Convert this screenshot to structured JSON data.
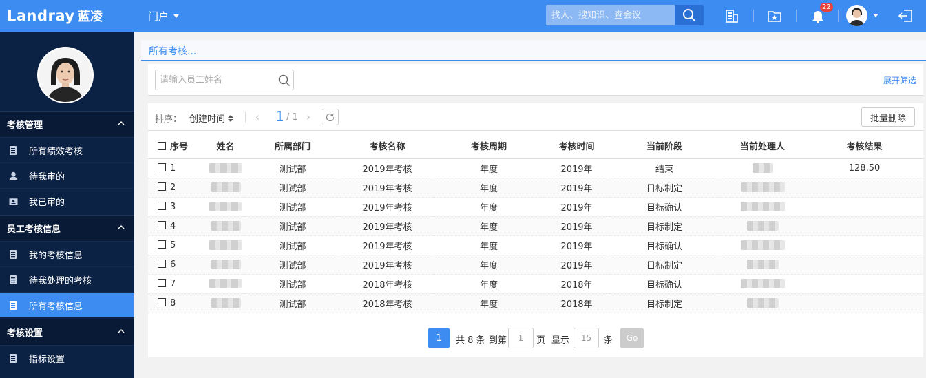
{
  "header": {
    "logo_text": "Landray",
    "logo_cn": "蓝凌",
    "portal_label": "门户",
    "search_placeholder": "找人、搜知识、查会议",
    "notification_count": "22",
    "accent_color": "#3d8cf1"
  },
  "sidebar": {
    "groups": [
      {
        "label": "考核管理",
        "items": [
          {
            "label": "所有绩效考核",
            "icon": "document-icon"
          },
          {
            "label": "待我审的",
            "icon": "user-icon"
          },
          {
            "label": "我已审的",
            "icon": "contact-card-icon"
          }
        ]
      },
      {
        "label": "员工考核信息",
        "items": [
          {
            "label": "我的考核信息",
            "icon": "document-icon"
          },
          {
            "label": "待我处理的考核",
            "icon": "document-icon"
          },
          {
            "label": "所有考核信息",
            "icon": "document-icon",
            "active": true
          }
        ]
      },
      {
        "label": "考核设置",
        "items": [
          {
            "label": "指标设置",
            "icon": "document-icon"
          }
        ]
      }
    ]
  },
  "main": {
    "breadcrumb": "所有考核...",
    "name_placeholder": "请输入员工姓名",
    "expand_filter": "展开筛选",
    "sort_label": "排序：",
    "sort_value": "创建时间",
    "page_current": "1",
    "page_total": "/ 1",
    "batch_delete": "批量删除",
    "columns": [
      "序号",
      "姓名",
      "所属部门",
      "考核名称",
      "考核周期",
      "考核时间",
      "当前阶段",
      "当前处理人",
      "考核结果"
    ],
    "rows": [
      {
        "no": "1",
        "dept": "测试部",
        "name": "2019年考核",
        "cycle": "年度",
        "time": "2019年",
        "stage": "结束",
        "result": "128.50"
      },
      {
        "no": "2",
        "dept": "测试部",
        "name": "2019年考核",
        "cycle": "年度",
        "time": "2019年",
        "stage": "目标制定",
        "result": ""
      },
      {
        "no": "3",
        "dept": "测试部",
        "name": "2019年考核",
        "cycle": "年度",
        "time": "2019年",
        "stage": "目标确认",
        "result": ""
      },
      {
        "no": "4",
        "dept": "测试部",
        "name": "2019年考核",
        "cycle": "年度",
        "time": "2019年",
        "stage": "目标制定",
        "result": ""
      },
      {
        "no": "5",
        "dept": "测试部",
        "name": "2019年考核",
        "cycle": "年度",
        "time": "2019年",
        "stage": "目标确认",
        "result": ""
      },
      {
        "no": "6",
        "dept": "测试部",
        "name": "2019年考核",
        "cycle": "年度",
        "time": "2019年",
        "stage": "目标制定",
        "result": ""
      },
      {
        "no": "7",
        "dept": "测试部",
        "name": "2018年考核",
        "cycle": "年度",
        "time": "2018年",
        "stage": "目标确认",
        "result": ""
      },
      {
        "no": "8",
        "dept": "测试部",
        "name": "2018年考核",
        "cycle": "年度",
        "time": "2018年",
        "stage": "目标制定",
        "result": ""
      }
    ],
    "pager": {
      "current": "1",
      "total_text": "共 8 条",
      "goto_label": "到第",
      "goto_value": "1",
      "page_unit": "页",
      "show_label": "显示",
      "page_size": "15",
      "size_unit": "条",
      "go_label": "Go"
    }
  }
}
